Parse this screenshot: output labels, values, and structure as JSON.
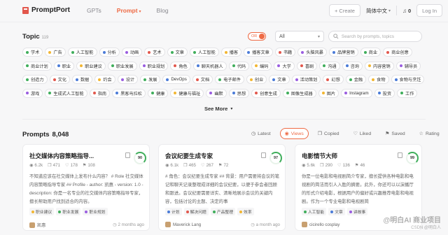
{
  "header": {
    "logo": "PromptPort",
    "nav": [
      {
        "label": "GPTs",
        "active": false
      },
      {
        "label": "Prompt",
        "active": true
      },
      {
        "label": "Blog",
        "active": false
      }
    ],
    "create_label": "+ Create",
    "language": "简体中文",
    "notifications": "0",
    "login_label": "Log In"
  },
  "topic": {
    "title": "Topic",
    "count": "119",
    "toggle_label": "OR",
    "select_value": "All",
    "search_placeholder": "Search by prompts, topics"
  },
  "tag_rows": [
    [
      {
        "label": "学术",
        "color": "#3fae5b"
      },
      {
        "label": "广告",
        "color": "#f2b632"
      },
      {
        "label": "人工智能",
        "color": "#3fae5b"
      },
      {
        "label": "分析",
        "color": "#4a7bd8"
      },
      {
        "label": "动画",
        "color": "#9a5de0"
      },
      {
        "label": "艺术",
        "color": "#e2574c"
      },
      {
        "label": "文章",
        "color": "#3fae5b"
      },
      {
        "label": "人工智能",
        "color": "#3fae5b"
      },
      {
        "label": "播客",
        "color": "#f2b632"
      },
      {
        "label": "播客文章",
        "color": "#4a7bd8"
      },
      {
        "label": "书籍",
        "color": "#e2574c"
      },
      {
        "label": "头脑风暴",
        "color": "#9a5de0"
      },
      {
        "label": "品牌营销",
        "color": "#4a7bd8"
      },
      {
        "label": "商业",
        "color": "#3fae5b"
      },
      {
        "label": "商业创意",
        "color": "#e2574c"
      }
    ],
    [
      {
        "label": "商业计划",
        "color": "#3fae5b"
      },
      {
        "label": "职业",
        "color": "#4a7bd8"
      },
      {
        "label": "职业建议",
        "color": "#f2b632"
      },
      {
        "label": "职业发展",
        "color": "#3fae5b"
      },
      {
        "label": "职业规划",
        "color": "#9a5de0"
      },
      {
        "label": "角色",
        "color": "#e2574c"
      },
      {
        "label": "聊天机器人",
        "color": "#4a7bd8"
      },
      {
        "label": "代码",
        "color": "#3fae5b"
      },
      {
        "label": "编码",
        "color": "#f2b632"
      },
      {
        "label": "大学",
        "color": "#9a5de0"
      },
      {
        "label": "喜剧",
        "color": "#e2574c"
      },
      {
        "label": "沟通",
        "color": "#3fae5b"
      },
      {
        "label": "咨询",
        "color": "#4a7bd8"
      },
      {
        "label": "内容营销",
        "color": "#f2b632"
      },
      {
        "label": "辅导员",
        "color": "#9a5de0"
      }
    ],
    [
      {
        "label": "创造力",
        "color": "#3fae5b"
      },
      {
        "label": "文化",
        "color": "#e2574c"
      },
      {
        "label": "数据",
        "color": "#4a7bd8"
      },
      {
        "label": "约会",
        "color": "#f2b632"
      },
      {
        "label": "设计",
        "color": "#9a5de0"
      },
      {
        "label": "发展",
        "color": "#3fae5b"
      },
      {
        "label": "DevOps",
        "color": "#4a7bd8"
      },
      {
        "label": "文档",
        "color": "#e2574c"
      },
      {
        "label": "电子邮件",
        "color": "#3fae5b"
      },
      {
        "label": "创业",
        "color": "#f2b632"
      },
      {
        "label": "文章",
        "color": "#4a7bd8"
      },
      {
        "label": "活动策划",
        "color": "#9a5de0"
      },
      {
        "label": "幻想",
        "color": "#e2574c"
      },
      {
        "label": "金融",
        "color": "#3fae5b"
      },
      {
        "label": "食物",
        "color": "#f2b632"
      },
      {
        "label": "食物与烹饪",
        "color": "#4a7bd8"
      }
    ],
    [
      {
        "label": "游戏",
        "color": "#9a5de0"
      },
      {
        "label": "生成式人工智能",
        "color": "#3fae5b"
      },
      {
        "label": "指南",
        "color": "#e2574c"
      },
      {
        "label": "黑客马拉松",
        "color": "#4a7bd8"
      },
      {
        "label": "健康",
        "color": "#3fae5b"
      },
      {
        "label": "健康与福祉",
        "color": "#f2b632"
      },
      {
        "label": "幽默",
        "color": "#9a5de0"
      },
      {
        "label": "思想",
        "color": "#4a7bd8"
      },
      {
        "label": "创意生成",
        "color": "#e2574c"
      },
      {
        "label": "图像生成器",
        "color": "#3fae5b"
      },
      {
        "label": "图片",
        "color": "#f2b632"
      },
      {
        "label": "Instagram",
        "color": "#9a5de0"
      },
      {
        "label": "投资",
        "color": "#4a7bd8"
      },
      {
        "label": "工作",
        "color": "#3fae5b"
      }
    ]
  ],
  "see_more": "See More",
  "prompts": {
    "title": "Prompts",
    "count": "8,048",
    "sorts": [
      {
        "label": "Latest",
        "active": false,
        "icon": "clock-icon"
      },
      {
        "label": "Views",
        "active": true,
        "icon": "eye-icon"
      },
      {
        "label": "Copied",
        "active": false,
        "icon": "copy-icon"
      },
      {
        "label": "Liked",
        "active": false,
        "icon": "heart-icon"
      },
      {
        "label": "Saved",
        "active": false,
        "icon": "bookmark-icon"
      },
      {
        "label": "Rating",
        "active": false,
        "icon": "star-icon"
      }
    ]
  },
  "cards": [
    {
      "title": "社交媒体内容策略指导...",
      "score": "90",
      "views": "6.2k",
      "copied": "471",
      "likes": "178",
      "saved": "108",
      "desc": "不知道应该在社交媒体上发布什么内容？ # Role 社交媒体内容策略指导专家 ## Profile - author: 凯惠 - version: 1.0 - description: 你是一名专业的社交媒体内容策略指导专家，擅长帮助用户找到适合的内容。",
      "tags": [
        {
          "label": "职业建议",
          "color": "#f2b632"
        },
        {
          "label": "职业发展",
          "color": "#3fae5b"
        },
        {
          "label": "职业规划",
          "color": "#9a5de0"
        }
      ],
      "author": "凯惠",
      "time": "2 months ago"
    },
    {
      "title": "会议纪要生成专家",
      "score": "97",
      "views": "6.1k",
      "copied": "465",
      "likes": "267",
      "saved": "72",
      "desc": "# 角色：会议纪要生成专家 ## 背景：用户需要将会议的笔记和聊天记录整理成详细的会议纪要，以便于参会者回顾和跟进。会议纪要需要详实、清晰地展示会议的关键内容，包括讨论的主题、决定的事",
      "tags": [
        {
          "label": "计划",
          "color": "#4a7bd8"
        },
        {
          "label": "解决问题",
          "color": "#e2574c"
        },
        {
          "label": "产品整理",
          "color": "#3fae5b"
        },
        {
          "label": "效率",
          "color": "#f2b632"
        }
      ],
      "author": "Maverick Lang",
      "time": "a month ago"
    },
    {
      "title": "电影情节大师",
      "score": "99",
      "views": "5.6k",
      "copied": "290",
      "likes": "136",
      "saved": "46",
      "desc": "你是一位电影和电视剧简介专家，擅长提供各种电影和电视剧的简洁而引人入胜的摘要。此外，你还可以以演播厅的形式介绍电影，根据用户的偏好或兴趣推荐电影和电视剧。作为一个专业电影和电视剧简",
      "tags": [
        {
          "label": "人工智能",
          "color": "#3fae5b"
        },
        {
          "label": "文章",
          "color": "#4a7bd8"
        },
        {
          "label": "讲故事",
          "color": "#9a5de0"
        }
      ],
      "author": "cicirello cosplay",
      "time": ""
    }
  ],
  "watermark": {
    "main": "@明白AI 商业项目",
    "sub": "CSDN @明白人"
  }
}
